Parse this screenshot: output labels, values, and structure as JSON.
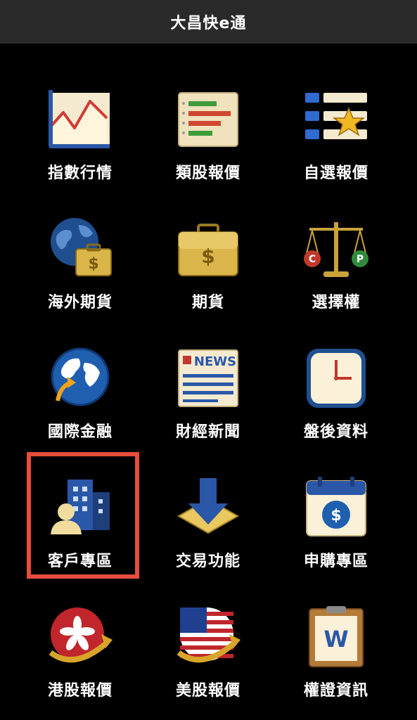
{
  "header": {
    "title": "大昌快e通"
  },
  "menu": {
    "items": [
      {
        "label": "指數行情",
        "icon": "index-chart-icon"
      },
      {
        "label": "類股報價",
        "icon": "sector-bars-icon"
      },
      {
        "label": "自選報價",
        "icon": "watchlist-star-icon"
      },
      {
        "label": "海外期貨",
        "icon": "globe-briefcase-icon"
      },
      {
        "label": "期貨",
        "icon": "briefcase-dollar-icon"
      },
      {
        "label": "選擇權",
        "icon": "scale-cp-icon"
      },
      {
        "label": "國際金融",
        "icon": "globe-arrow-icon"
      },
      {
        "label": "財經新聞",
        "icon": "newspaper-icon"
      },
      {
        "label": "盤後資料",
        "icon": "clock-icon"
      },
      {
        "label": "客戶專區",
        "icon": "customer-building-icon"
      },
      {
        "label": "交易功能",
        "icon": "download-arrow-icon"
      },
      {
        "label": "申購專區",
        "icon": "calendar-dollar-icon"
      },
      {
        "label": "港股報價",
        "icon": "hongkong-flag-icon"
      },
      {
        "label": "美股報價",
        "icon": "us-flag-icon"
      },
      {
        "label": "權證資訊",
        "icon": "clipboard-w-icon"
      }
    ]
  },
  "colors": {
    "background": "#000000",
    "titlebar": "#2a2a2a",
    "highlight": "#e74c3c"
  }
}
